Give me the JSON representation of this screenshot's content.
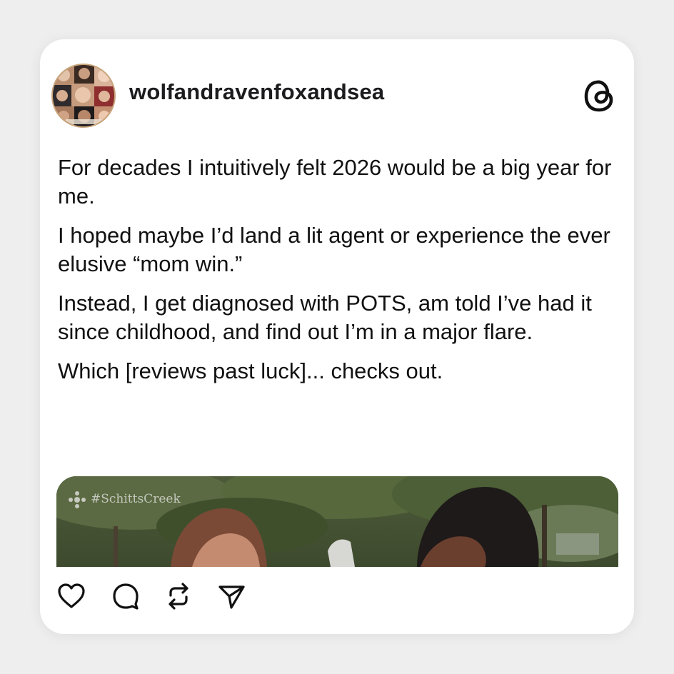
{
  "post": {
    "username": "wolfandravenfoxandsea",
    "avatar_icon": "avatar-collage",
    "platform_icon": "threads-logo-icon",
    "paragraphs": [
      "For decades I intuitively felt 2026 would be a big year for me.",
      "I hoped maybe I’d land a lit agent or experience the ever elusive “mom win.”",
      "Instead, I get diagnosed with POTS, am told I’ve had it since childhood, and find out I’m in a major flare.",
      "Which [reviews past luck]... checks out."
    ],
    "media": {
      "watermark": "#SchittsCreek"
    }
  },
  "actions": [
    {
      "name": "like-button",
      "icon": "heart-icon"
    },
    {
      "name": "reply-button",
      "icon": "comment-icon"
    },
    {
      "name": "repost-button",
      "icon": "repost-icon"
    },
    {
      "name": "share-button",
      "icon": "send-icon"
    }
  ]
}
